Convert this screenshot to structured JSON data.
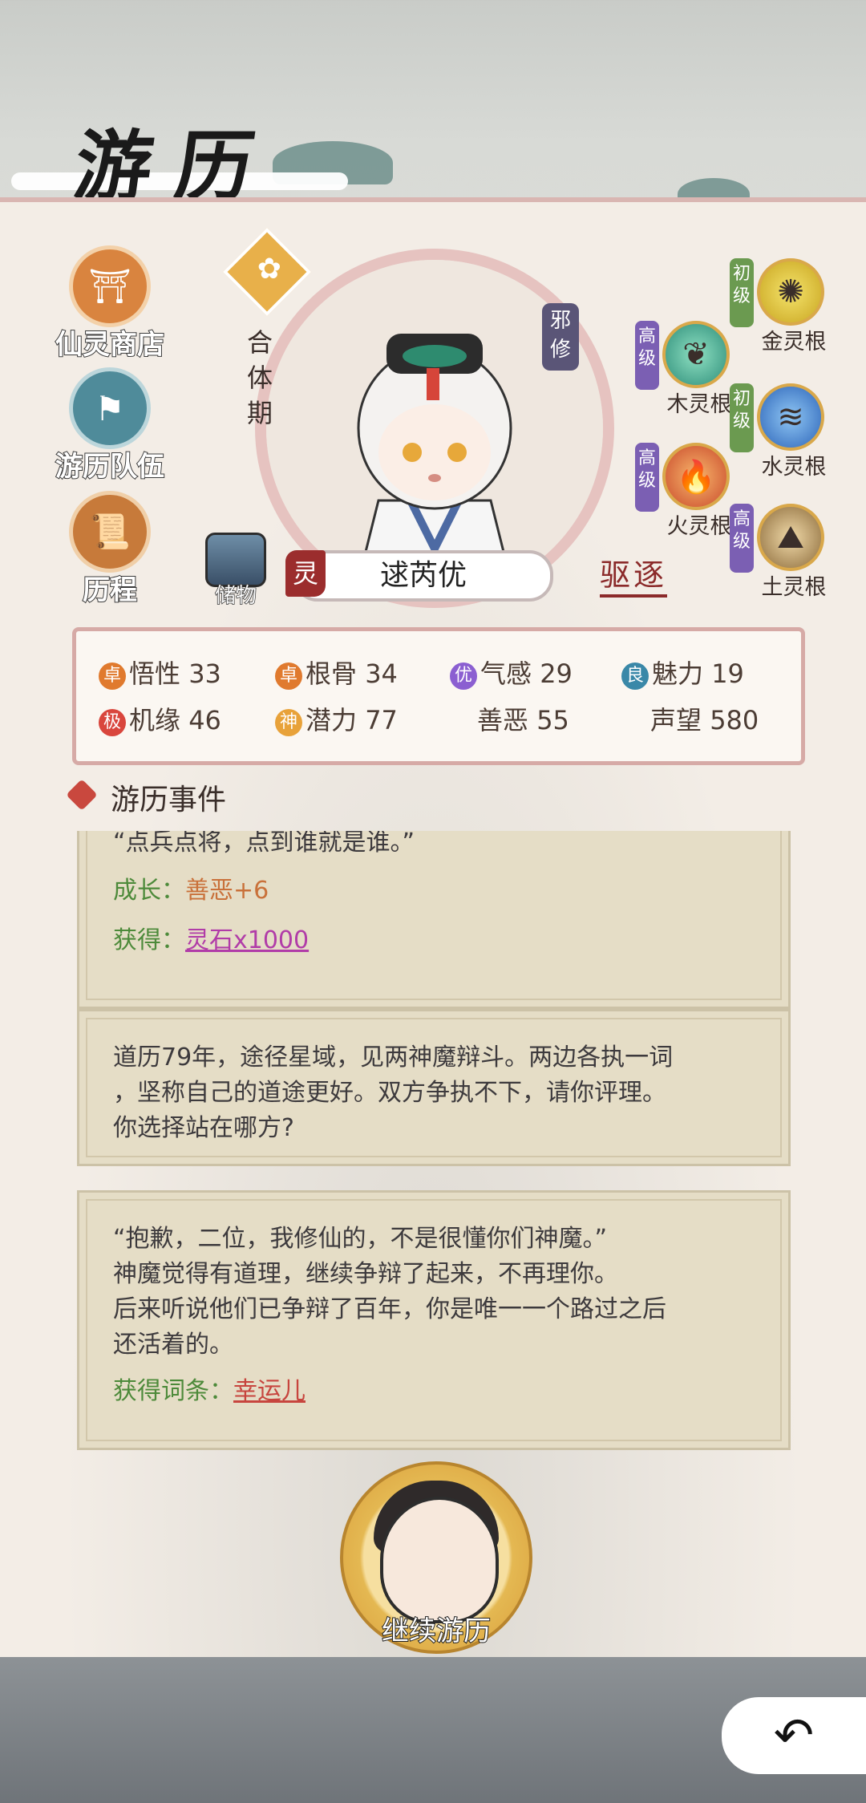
{
  "header": {
    "title": "游历"
  },
  "menu": [
    {
      "label": "仙灵商店",
      "icon": "shop-gate-icon"
    },
    {
      "label": "游历队伍",
      "icon": "team-flag-icon"
    },
    {
      "label": "历程",
      "icon": "scroll-icon"
    }
  ],
  "character": {
    "realm": "合体期",
    "tag": "邪修",
    "spirit_badge": "灵",
    "name": "逑芮优",
    "storage_label": "储物",
    "expel_label": "驱逐"
  },
  "roots": [
    {
      "grade": "初级",
      "label": "金灵根",
      "grade_color": "#6b9a50",
      "icon": "metal-root-icon"
    },
    {
      "grade": "高级",
      "label": "木灵根",
      "grade_color": "#7b5fb3",
      "icon": "wood-root-icon"
    },
    {
      "grade": "初级",
      "label": "水灵根",
      "grade_color": "#6b9a50",
      "icon": "water-root-icon"
    },
    {
      "grade": "高级",
      "label": "火灵根",
      "grade_color": "#7b5fb3",
      "icon": "fire-root-icon"
    },
    {
      "grade": "高级",
      "label": "土灵根",
      "grade_color": "#7b5fb3",
      "icon": "earth-root-icon"
    }
  ],
  "stats": [
    {
      "badge": "卓",
      "badge_color": "#e07a2e",
      "label": "悟性",
      "value": "33"
    },
    {
      "badge": "卓",
      "badge_color": "#e07a2e",
      "label": "根骨",
      "value": "34"
    },
    {
      "badge": "优",
      "badge_color": "#8b5fd1",
      "label": "气感",
      "value": "29"
    },
    {
      "badge": "良",
      "badge_color": "#3a88a8",
      "label": "魅力",
      "value": "19"
    },
    {
      "badge": "极",
      "badge_color": "#d9463d",
      "label": "机缘",
      "value": "46"
    },
    {
      "badge": "神",
      "badge_color": "#e8a23a",
      "label": "潜力",
      "value": "77"
    },
    {
      "badge": "",
      "badge_color": "",
      "label": "善恶",
      "value": "55"
    },
    {
      "badge": "",
      "badge_color": "",
      "label": "声望",
      "value": "580"
    }
  ],
  "events": {
    "heading": "游历事件",
    "card1": {
      "quote": "“点兵点将，点到谁就是谁。”",
      "growth_label": "成长：",
      "growth_value": "善恶+6",
      "gain_label": "获得：",
      "gain_value": "灵石x1000"
    },
    "card2": {
      "line1": "道历79年，途径星域，见两神魔辩斗。两边各执一词",
      "line2": "，坚称自己的道途更好。双方争执不下，请你评理。",
      "line3": "你选择站在哪方?"
    },
    "card3": {
      "line1": "“抱歉，二位，我修仙的，不是很懂你们神魔。”",
      "line2": "神魔觉得有道理，继续争辩了起来，不再理你。",
      "line3": "后来听说他们已争辩了百年，你是唯一一个路过之后",
      "line4": "还活着的。",
      "gain_label": "获得词条：",
      "gain_value": "幸运儿"
    }
  },
  "continue_label": "继续游历"
}
